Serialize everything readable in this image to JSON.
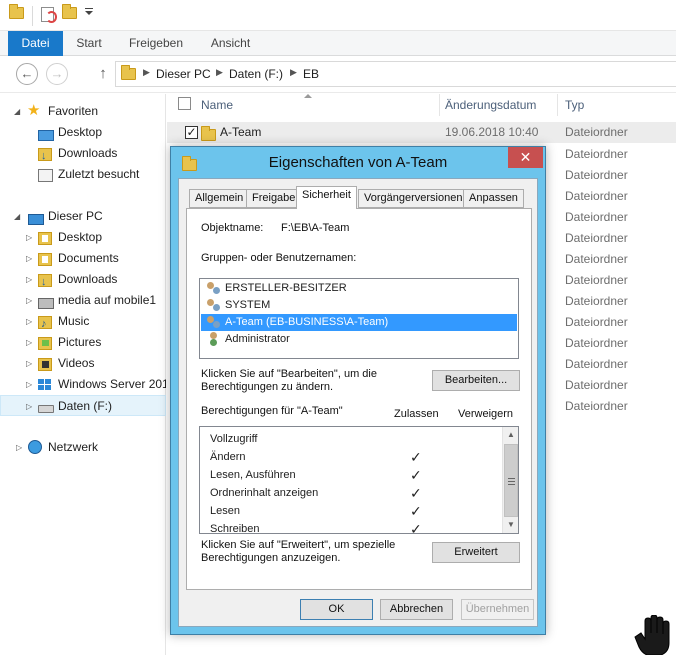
{
  "ribbon": {
    "tabs": [
      "Datei",
      "Start",
      "Freigeben",
      "Ansicht"
    ]
  },
  "address": {
    "crumbs": [
      "Dieser PC",
      "Daten (F:)",
      "EB"
    ]
  },
  "nav": {
    "favorites_label": "Favoriten",
    "favorites": [
      "Desktop",
      "Downloads",
      "Zuletzt besucht"
    ],
    "pc_label": "Dieser PC",
    "pc_items": [
      "Desktop",
      "Documents",
      "Downloads",
      "media auf mobile1",
      "Music",
      "Pictures",
      "Videos",
      "Windows Server 201",
      "Daten (F:)"
    ],
    "network_label": "Netzwerk"
  },
  "filelist": {
    "columns": {
      "name": "Name",
      "date": "Änderungsdatum",
      "type": "Typ"
    },
    "rows": [
      {
        "name": "A-Team",
        "date": "19.06.2018 10:40",
        "type": "Dateiordner",
        "checked": true
      },
      {
        "type": "Dateiordner"
      },
      {
        "type": "Dateiordner"
      },
      {
        "type": "Dateiordner"
      },
      {
        "type": "Dateiordner"
      },
      {
        "type": "Dateiordner"
      },
      {
        "type": "Dateiordner"
      },
      {
        "type": "Dateiordner"
      },
      {
        "type": "Dateiordner"
      },
      {
        "type": "Dateiordner"
      },
      {
        "type": "Dateiordner"
      },
      {
        "type": "Dateiordner"
      },
      {
        "type": "Dateiordner"
      },
      {
        "type": "Dateiordner"
      }
    ]
  },
  "dialog": {
    "title": "Eigenschaften von A-Team",
    "close_label": "✕",
    "tabs": [
      "Allgemein",
      "Freigabe",
      "Sicherheit",
      "Vorgängerversionen",
      "Anpassen"
    ],
    "object_label": "Objektname:",
    "object_value": "F:\\EB\\A-Team",
    "groups_label": "Gruppen- oder Benutzernamen:",
    "principals": [
      "ERSTELLER-BESITZER",
      "SYSTEM",
      "A-Team (EB-BUSINESS\\A-Team)",
      "Administrator"
    ],
    "selected_principal": 2,
    "edit_hint_line1": "Klicken Sie auf \"Bearbeiten\", um die",
    "edit_hint_line2": "Berechtigungen zu ändern.",
    "edit_button": "Bearbeiten...",
    "perm_label": "Berechtigungen für \"A-Team\"",
    "allow_header": "Zulassen",
    "deny_header": "Verweigern",
    "permissions": [
      {
        "name": "Vollzugriff",
        "allow": false
      },
      {
        "name": "Ändern",
        "allow": true
      },
      {
        "name": "Lesen, Ausführen",
        "allow": true
      },
      {
        "name": "Ordnerinhalt anzeigen",
        "allow": true
      },
      {
        "name": "Lesen",
        "allow": true
      },
      {
        "name": "Schreiben",
        "allow": true
      }
    ],
    "check_glyph": "✓",
    "advanced_hint_line1": "Klicken Sie auf \"Erweitert\", um spezielle",
    "advanced_hint_line2": "Berechtigungen anzuzeigen.",
    "advanced_button": "Erweitert",
    "ok_button": "OK",
    "cancel_button": "Abbrechen",
    "apply_button": "Übernehmen"
  },
  "colors": {
    "accent": "#1979ca",
    "dialog_frame": "#6cc4ec",
    "selection": "#3399ff",
    "close": "#c75050"
  }
}
